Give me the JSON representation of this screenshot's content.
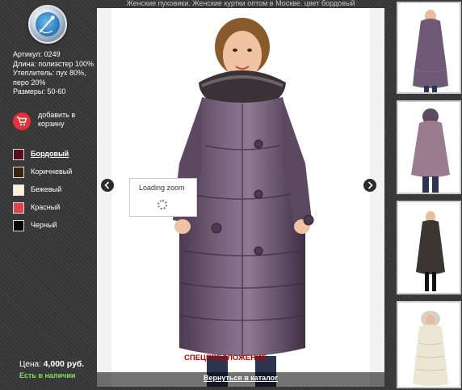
{
  "page": {
    "title": "Женские пуховики. Женские куртки оптом в Москве. цвет бордовый"
  },
  "product": {
    "article": "Артикул: 0249",
    "length": "Длина: полиэстер 100%",
    "filling": "Утеплитель: пух 80%, перо 20%",
    "sizes": "Размеры: 50-60"
  },
  "cart": {
    "label": "добавить в корзину",
    "icon": "shopping-cart-icon"
  },
  "colors": [
    {
      "name": "Бордовый",
      "hex": "#5a0d1c",
      "active": true
    },
    {
      "name": "Коричневый",
      "hex": "#3a220e",
      "active": false
    },
    {
      "name": "Бежевый",
      "hex": "#f7f2d8",
      "active": false
    },
    {
      "name": "Красный",
      "hex": "#e0434f",
      "active": false
    },
    {
      "name": "Черный",
      "hex": "#050505",
      "active": false
    }
  ],
  "price": {
    "label": "Цена:",
    "value": "4,000 руб."
  },
  "stock": "Есть в наличии",
  "viewer": {
    "loading": "Loading zoom",
    "tag": "СПЕЦПРЕДЛОЖЕНИЕ",
    "back": "Вернуться в каталог"
  }
}
